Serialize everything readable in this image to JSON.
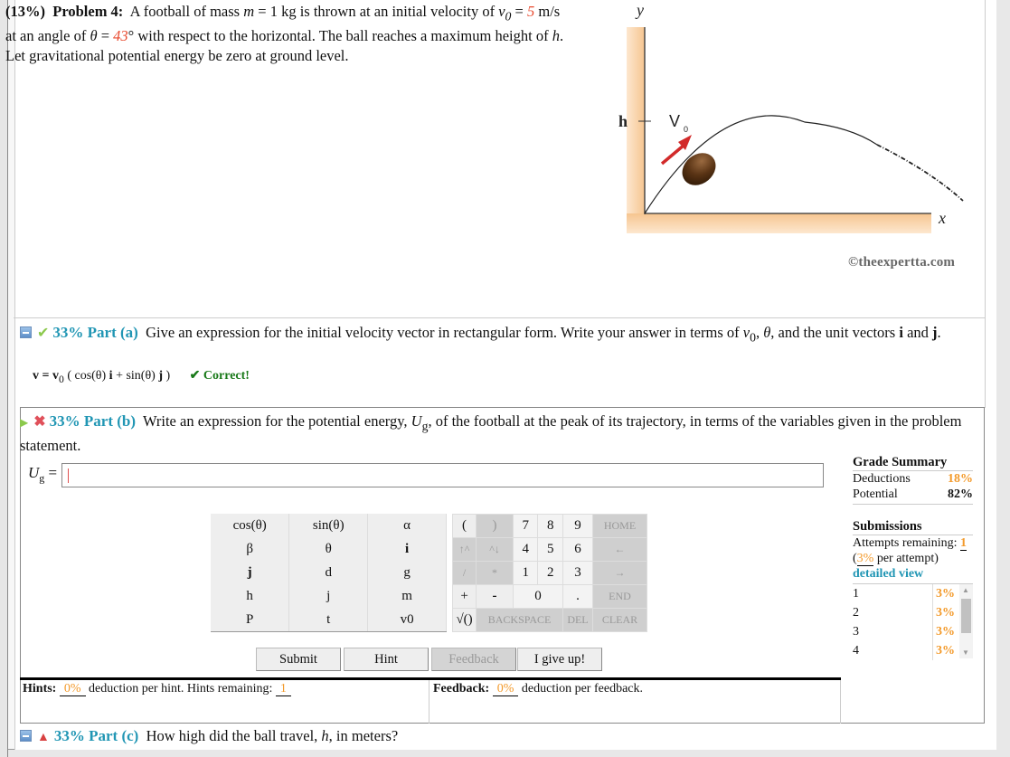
{
  "problem": {
    "weight": "(13%)",
    "label": "Problem 4:",
    "text_1": "A football of mass",
    "mass_var": "m",
    "mass_text": " = 1 kg is thrown at an initial velocity of ",
    "v0_var": "v",
    "v0_sub": "0",
    "v0_eq": " = ",
    "v0_value": "5",
    "text_2": "m/s at an angle of ",
    "theta_var": "θ",
    "theta_eq": " = ",
    "theta_value": "43",
    "text_3": "° with respect to the horizontal. The ball reaches a maximum height of ",
    "h_var": "h",
    "text_4": ". Let gravitational potential energy be zero at ground level."
  },
  "figure": {
    "y_label": "y",
    "x_label": "x",
    "h_label": "h",
    "v_label": "V",
    "v_sub": "0",
    "copyright": "©theexpertta.com"
  },
  "part_a": {
    "percent_label": "33% Part (a)",
    "question_1": "Give an expression for the initial velocity vector in rectangular form. Write your answer in terms of ",
    "question_v0": "v",
    "question_v0_sub": "0",
    "question_2": ", ",
    "question_theta": "θ",
    "question_3": ", and the unit vectors ",
    "question_i": "i",
    "question_4": " and ",
    "question_j": "j",
    "question_5": ".",
    "answer": "v = v",
    "answer_sub": "0",
    "answer_rest_1": " ( cos(θ) ",
    "answer_i": "i",
    "answer_rest_2": " + sin(θ) ",
    "answer_j": "j",
    "answer_rest_3": " )",
    "status": "✔ Correct!"
  },
  "part_b": {
    "percent_label": "33% Part (b)",
    "question_1": "Write an expression for the potential energy, ",
    "question_ug": "U",
    "question_ug_sub": "g",
    "question_2": ", of the football at the peak of its trajectory, in terms of the variables given in the problem statement.",
    "input_label": "U",
    "input_label_sub": "g",
    "input_eq": " =",
    "input_value": ""
  },
  "keypad": {
    "vars": [
      [
        "cos(θ)",
        "sin(θ)",
        "α"
      ],
      [
        "β",
        "θ",
        "i"
      ],
      [
        "j",
        "d",
        "g"
      ],
      [
        "h",
        "j",
        "m"
      ],
      [
        "P",
        "t",
        "v0"
      ]
    ],
    "num": {
      "open_paren": "(",
      "close_paren": ")",
      "k7": "7",
      "k8": "8",
      "k9": "9",
      "home": "HOME",
      "up": "↑^",
      "down": "^↓",
      "k4": "4",
      "k5": "5",
      "k6": "6",
      "left": "←",
      "div": "/",
      "mul": "*",
      "k1": "1",
      "k2": "2",
      "k3": "3",
      "right": "→",
      "plus": "+",
      "minus": "-",
      "k0": "0",
      "dot": ".",
      "end": "END",
      "sqrt": "√()",
      "backspace": "BACKSPACE",
      "del": "DEL",
      "clear": "CLEAR"
    }
  },
  "buttons": {
    "submit": "Submit",
    "hint": "Hint",
    "feedback": "Feedback",
    "give_up": "I give up!"
  },
  "hints": {
    "label": "Hints:",
    "deduction": "0%",
    "text": "deduction per hint. Hints remaining:",
    "remaining": "1"
  },
  "feedback": {
    "label": "Feedback:",
    "deduction": "0%",
    "text": "deduction per feedback."
  },
  "grade_summary": {
    "title": "Grade Summary",
    "deductions_label": "Deductions",
    "deductions_value": "18%",
    "potential_label": "Potential",
    "potential_value": "82%"
  },
  "submissions": {
    "title": "Submissions",
    "attempts_label": "Attempts remaining:",
    "attempts_value": "1",
    "per_attempt_open": "(",
    "per_attempt_value": "3%",
    "per_attempt_text": " per attempt)",
    "detailed_view": "detailed view",
    "list": [
      {
        "n": "1",
        "p": "3%"
      },
      {
        "n": "2",
        "p": "3%"
      },
      {
        "n": "3",
        "p": "3%"
      },
      {
        "n": "4",
        "p": "3%"
      }
    ]
  },
  "part_c": {
    "percent_label": "33% Part (c)",
    "question_1": "How high did the ball travel, ",
    "question_h": "h",
    "question_2": ", in meters?"
  },
  "colors": {
    "accent_blue": "#2196b4",
    "orange": "#f39a2b",
    "red_value": "#e8492e",
    "correct_green": "#1a7a1a"
  }
}
